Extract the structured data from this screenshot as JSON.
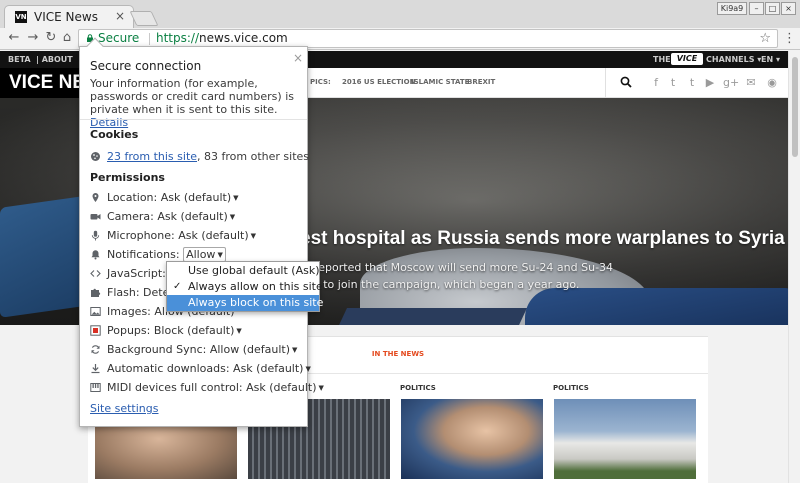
{
  "browser": {
    "tab_title": "VICE News",
    "tab_favicon": "VN",
    "tab_close": "×",
    "window_buttons": [
      "Ki9a9",
      "–",
      "□",
      "×"
    ],
    "omnibox": {
      "secure_label": "Secure",
      "scheme": "https://",
      "host": "news.vice.com"
    },
    "icons": [
      "back-icon",
      "forward-icon",
      "reload-icon",
      "home-icon",
      "lock-icon",
      "star-icon",
      "menu-icon"
    ]
  },
  "page": {
    "topbar": {
      "beta": "BETA",
      "about": "ABOUT",
      "the": "THE",
      "vice_logo": "VICE",
      "channels": "CHANNELS ▾",
      "lang": "EN ▾"
    },
    "nav": {
      "logo": "VICE NEWS",
      "topics_label": "PICS:",
      "topics": [
        "2016 US ELECTION",
        "ISLAMIC STATE",
        "BREXIT"
      ],
      "social_icons": [
        "facebook-icon",
        "twitter-icon",
        "tumblr-icon",
        "youtube-icon",
        "googleplus-icon",
        "email-icon",
        "rss-icon"
      ],
      "social_glyphs": [
        "f",
        "t",
        "t",
        "▶",
        "g+",
        "✉",
        "◉"
      ]
    },
    "hero": {
      "headline": "est hospital as Russia sends more warplanes to Syria",
      "dek_line1": "reported that Moscow will send more Su-24 and Su-34",
      "dek_line2": "s to join the campaign, which began a year ago."
    },
    "in_the_news": {
      "heading": "IN THE NEWS",
      "categories": [
        "POLITICS",
        "POLITICS"
      ]
    }
  },
  "page_info": {
    "close": "×",
    "title": "Secure connection",
    "info_text": "Your information (for example, passwords or credit card numbers) is private when it is sent to this site.",
    "details_link": "Details",
    "cookies_heading": "Cookies",
    "cookies_link": "23 from this site",
    "cookies_rest": ", 83 from other sites",
    "permissions_heading": "Permissions",
    "permissions": [
      {
        "label": "Location:",
        "value": "Ask (default)",
        "icon": "location-icon"
      },
      {
        "label": "Camera:",
        "value": "Ask (default)",
        "icon": "camera-icon"
      },
      {
        "label": "Microphone:",
        "value": "Ask (default)",
        "icon": "microphone-icon"
      },
      {
        "label": "Notifications:",
        "value": "Allow",
        "icon": "bell-icon"
      },
      {
        "label": "JavaScript:",
        "value": "A",
        "icon": "code-icon"
      },
      {
        "label": "Flash:",
        "value": "Detec",
        "icon": "puzzle-icon"
      },
      {
        "label": "Images:",
        "value": "Allow (default)",
        "icon": "image-icon"
      },
      {
        "label": "Popups:",
        "value": "Block (default)",
        "icon": "popup-icon"
      },
      {
        "label": "Background Sync:",
        "value": "Allow (default)",
        "icon": "sync-icon"
      },
      {
        "label": "Automatic downloads:",
        "value": "Ask (default)",
        "icon": "download-icon"
      },
      {
        "label": "MIDI devices full control:",
        "value": "Ask (default)",
        "icon": "midi-icon"
      }
    ],
    "site_settings_link": "Site settings",
    "dropdown": {
      "options": [
        "Use global default (Ask)",
        "Always allow on this site",
        "Always block on this site"
      ],
      "checked_index": 1,
      "highlighted_index": 2
    }
  },
  "colors": {
    "secure_green": "#0b8043",
    "link_blue": "#2a5db0",
    "highlight_blue": "#4a90d9",
    "vice_orange": "#e44a1f"
  }
}
